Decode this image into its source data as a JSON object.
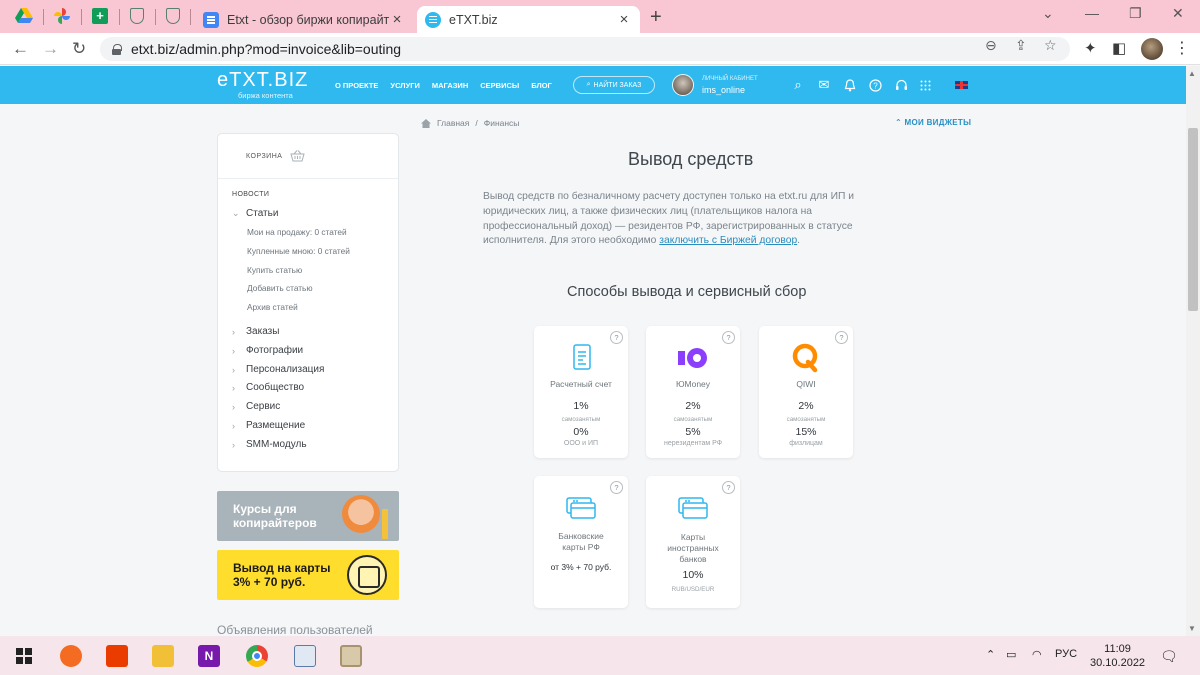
{
  "browser": {
    "tabs": [
      {
        "title": "Etxt - обзор биржи копирайтин",
        "active": false
      },
      {
        "title": "eTXT.biz",
        "active": true
      }
    ],
    "url": "etxt.biz/admin.php?mod=invoice&lib=outing"
  },
  "header": {
    "logo": "eTXT.BIZ",
    "logo_sub": "биржа контента",
    "menu": [
      "О ПРОЕКТЕ",
      "УСЛУГИ",
      "МАГАЗИН",
      "СЕРВИСЫ",
      "БЛОГ"
    ],
    "find_order": "НАЙТИ ЗАКАЗ",
    "cabinet_label": "ЛИЧНЫЙ КАБИНЕТ",
    "username": "ims_online"
  },
  "breadcrumb": {
    "home": "Главная",
    "sep": "/",
    "current": "Финансы"
  },
  "widgets_link": "МОИ ВИДЖЕТЫ",
  "sidebar": {
    "cart": "КОРЗИНА",
    "news": "НОВОСТИ",
    "articles": "Статьи",
    "article_links": [
      "Мои на продажу: 0 статей",
      "Купленные мною: 0 статей",
      "Купить статью",
      "Добавить статью",
      "Архив статей"
    ],
    "sections": [
      "Заказы",
      "Фотографии",
      "Персонализация",
      "Сообщество",
      "Сервис",
      "Размещение",
      "SMM-модуль"
    ]
  },
  "banners": {
    "courses": "Курсы для копирайтеров",
    "cards_line1": "Вывод на карты",
    "cards_line2": "3% + 70 руб."
  },
  "ads_title": "Объявления пользователей",
  "main": {
    "title": "Вывод средств",
    "description": "Вывод средств по безналичному расчету доступен только на etxt.ru для ИП и юридических лиц, а также физических лиц (плательщиков налога на профессиональный доход) — резидентов РФ, зарегистрированных в статусе исполнителя. Для этого необходимо ",
    "description_link": "заключить с Биржей договор",
    "description_end": ".",
    "methods_title": "Способы вывода и сервисный сбор",
    "help_mark": "?",
    "methods": [
      {
        "name": "Расчетный счет",
        "fee1": "1%",
        "label1": "самозанятым",
        "fee2": "0%",
        "label2": "ООО и ИП",
        "icon": "invoice-icon"
      },
      {
        "name": "ЮMoney",
        "fee1": "2%",
        "label1": "самозанятым",
        "fee2": "5%",
        "label2": "нерезидентам РФ",
        "icon": "yoomoney-icon"
      },
      {
        "name": "QIWI",
        "fee1": "2%",
        "label1": "самозанятым",
        "fee2": "15%",
        "label2": "физлицам",
        "icon": "qiwi-icon"
      },
      {
        "name_line1": "Банковские",
        "name_line2": "карты РФ",
        "fee": "от 3% + 70 руб.",
        "icon": "bank-card-icon"
      },
      {
        "name_line1": "Карты",
        "name_line2": "иностранных",
        "name_line3": "банков",
        "fee": "10%",
        "label": "RUB/USD/EUR",
        "icon": "foreign-card-icon"
      }
    ]
  },
  "taskbar": {
    "lang": "РУС",
    "time": "11:09",
    "date": "30.10.2022"
  },
  "colors": {
    "header": "#2fb9ee",
    "tab_bar": "#f8c7d3",
    "yoomoney": "#8b3ffd",
    "qiwi": "#ff8c00",
    "link": "#2a8cbe"
  }
}
